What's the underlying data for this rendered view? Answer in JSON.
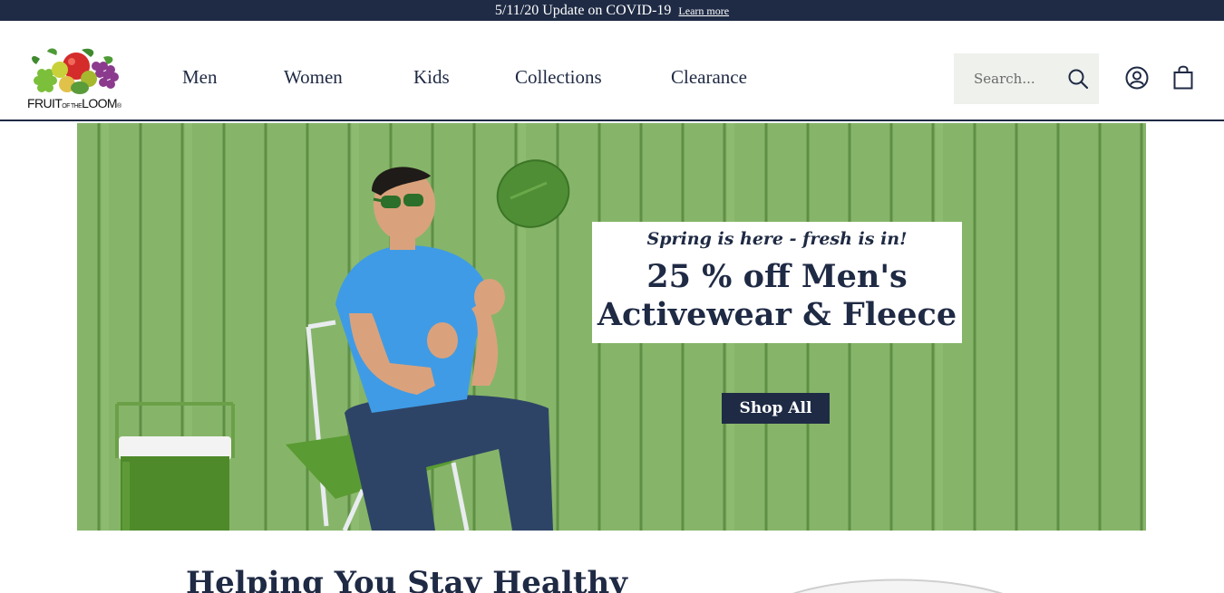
{
  "announcement": {
    "text": "5/11/20 Update on COVID-19",
    "link": "Learn more"
  },
  "brand": {
    "logo_text": "FRUIT",
    "logo_mid": "OF THE",
    "logo_end": "LOOM",
    "logo_reg": "®"
  },
  "nav": [
    {
      "label": "Men"
    },
    {
      "label": "Women"
    },
    {
      "label": "Kids"
    },
    {
      "label": "Collections"
    },
    {
      "label": "Clearance"
    }
  ],
  "search": {
    "placeholder": "Search..."
  },
  "icons": {
    "search": "search-icon",
    "account": "account-icon",
    "cart": "shopping-bag-icon"
  },
  "hero": {
    "eyebrow": "Spring is here - fresh is in!",
    "headline_line1": "25 % off Men's",
    "headline_line2": "Activewear & Fleece",
    "cta": "Shop All"
  },
  "section": {
    "title": "Helping You Stay Healthy"
  },
  "colors": {
    "navy": "#1f2b45",
    "hero_green": "#87b56a",
    "search_bg": "#eef1ec"
  }
}
